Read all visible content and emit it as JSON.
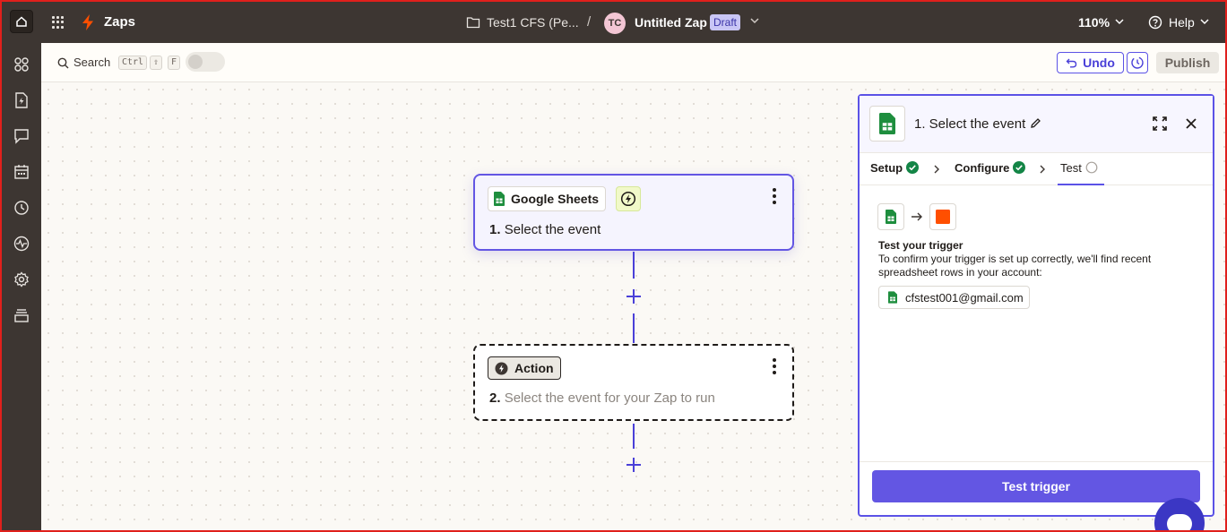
{
  "topbar": {
    "app_title": "Zaps",
    "folder_name": "Test1 CFS (Pe...",
    "separator": "/",
    "avatar_initials": "TC",
    "zap_name": "Untitled Zap",
    "status_badge": "Draft",
    "zoom_level": "110%",
    "help_label": "Help"
  },
  "sidebar": {
    "icons": [
      "apps-grid-icon",
      "zap-file-icon",
      "chat-icon",
      "calendar-icon",
      "history-icon",
      "activity-icon",
      "settings-icon",
      "archive-icon"
    ]
  },
  "toolbar": {
    "search_label": "Search",
    "shortcut_keys": [
      "Ctrl",
      "⇧",
      "F"
    ],
    "undo_label": "Undo",
    "publish_label": "Publish"
  },
  "canvas": {
    "steps": [
      {
        "app_label": "Google Sheets",
        "number": "1.",
        "title": "Select the event"
      },
      {
        "app_label": "Action",
        "number": "2.",
        "title": "Select the event for your Zap to run"
      }
    ]
  },
  "panel": {
    "title": "1. Select the event",
    "tabs": [
      {
        "label": "Setup",
        "status": "complete"
      },
      {
        "label": "Configure",
        "status": "complete"
      },
      {
        "label": "Test",
        "status": "pending"
      }
    ],
    "test_heading": "Test your trigger",
    "test_description": "To confirm your trigger is set up correctly, we'll find recent spreadsheet rows in your account:",
    "account": "cfstest001@gmail.com",
    "test_button": "Test trigger"
  },
  "colors": {
    "accent": "#6356e3",
    "topbar_bg": "#3d3632",
    "sheets_green": "#1e8e3e",
    "zapier_orange": "#ff4f00",
    "complete_green": "#138546"
  }
}
